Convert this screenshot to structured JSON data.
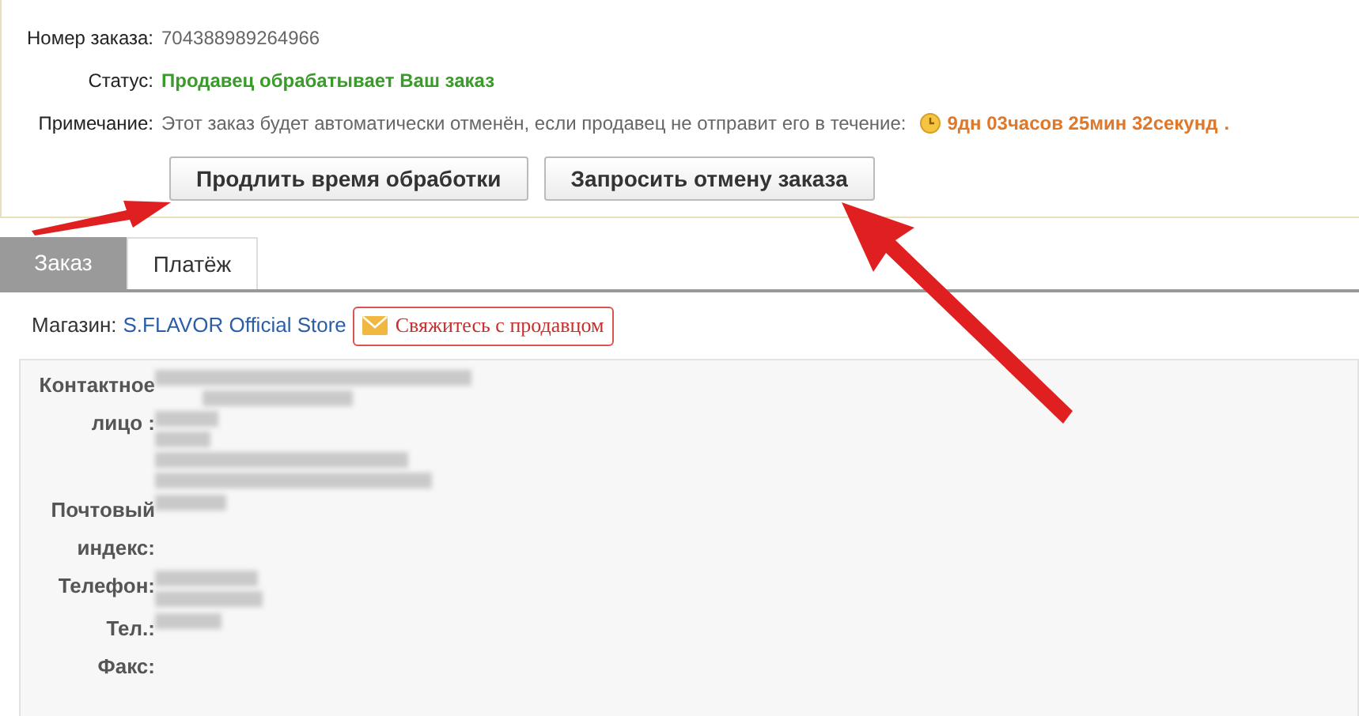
{
  "order_info": [
    {
      "label": "Номер заказа:",
      "value": "704388989264966",
      "kind": "plain"
    },
    {
      "label": "Статус:",
      "value": "Продавец обрабатывает Ваш заказ",
      "kind": "status"
    },
    {
      "label": "Примечание:",
      "value": "Этот заказ будет автоматически отменён, если продавец не отправит его в течение:",
      "kind": "note",
      "timer": "9дн 03часов 25мин 32секунд",
      "suffix": "."
    }
  ],
  "buttons": [
    "Продлить время обработки",
    "Запросить отмену заказа"
  ],
  "tabs": [
    {
      "label": "Заказ",
      "selected": true
    },
    {
      "label": "Платёж",
      "selected": false
    }
  ],
  "store": {
    "label": "Магазин:",
    "name": "S.FLAVOR Official Store",
    "contact_button": "Свяжитесь с продавцом"
  },
  "contact_fields": [
    {
      "label": "Контактное лицо :",
      "redacted": true
    },
    {
      "label": "Почтовый индекс:",
      "redacted": true
    },
    {
      "label": "Телефон:",
      "redacted": true
    },
    {
      "label": "Тел.:",
      "redacted": true
    },
    {
      "label": "Факс:",
      "redacted": false
    }
  ]
}
